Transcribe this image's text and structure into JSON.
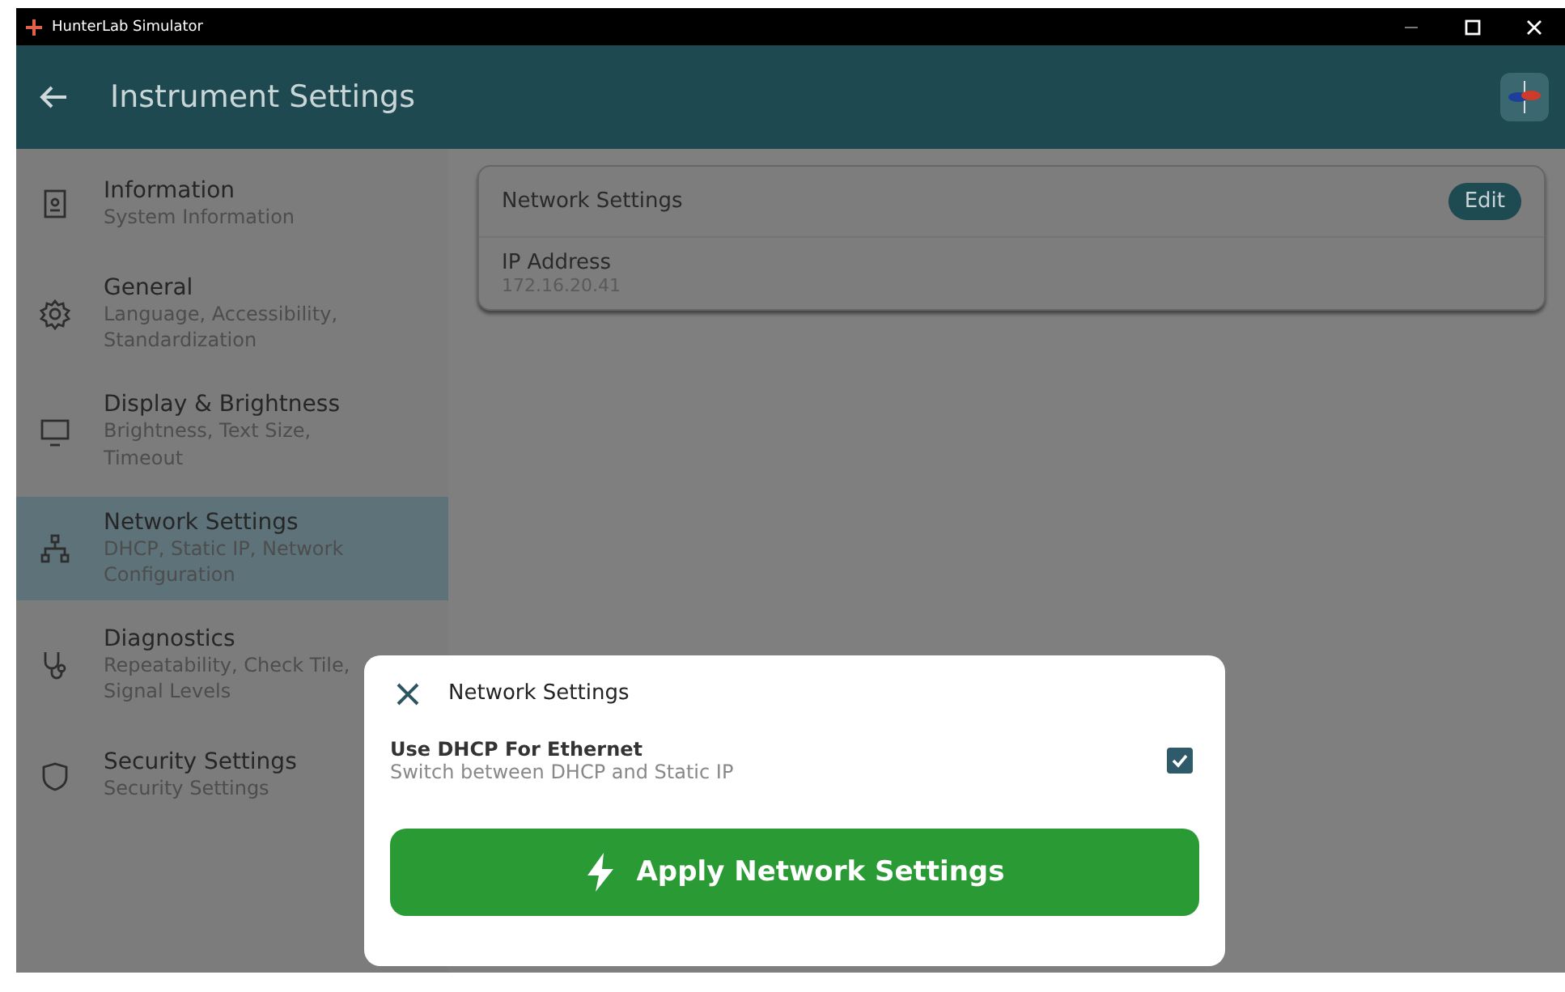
{
  "window": {
    "title": "HunterLab Simulator"
  },
  "header": {
    "title": "Instrument Settings"
  },
  "sidebar": {
    "items": [
      {
        "title": "Information",
        "subtitle": "System Information",
        "selected": false
      },
      {
        "title": "General",
        "subtitle": "Language, Accessibility, Standardization",
        "selected": false
      },
      {
        "title": "Display & Brightness",
        "subtitle": "Brightness, Text Size, Timeout",
        "selected": false
      },
      {
        "title": "Network Settings",
        "subtitle": "DHCP, Static IP, Network Configuration",
        "selected": true
      },
      {
        "title": "Diagnostics",
        "subtitle": "Repeatability, Check Tile, Signal Levels",
        "selected": false
      },
      {
        "title": "Security Settings",
        "subtitle": "Security Settings",
        "selected": false
      }
    ]
  },
  "card": {
    "title": "Network Settings",
    "edit_button": "Edit",
    "field_label": "IP Address",
    "field_value": "172.16.20.41"
  },
  "dialog": {
    "title": "Network Settings",
    "option": {
      "label": "Use DHCP For Ethernet",
      "description": "Switch between DHCP and Static IP",
      "checked": true
    },
    "apply_button": "Apply Network Settings"
  }
}
